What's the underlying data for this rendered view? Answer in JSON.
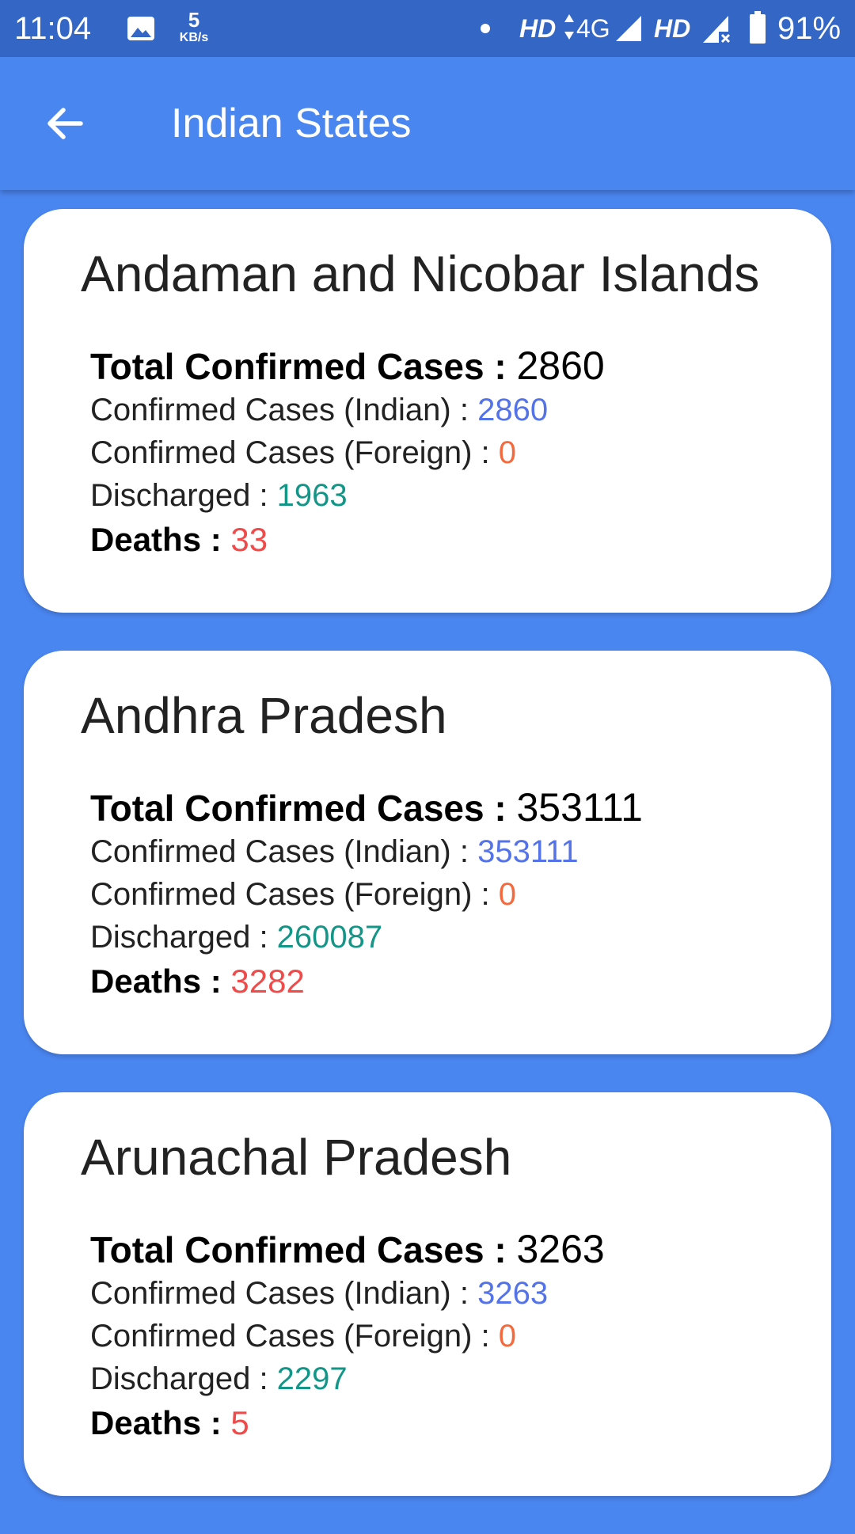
{
  "status_bar": {
    "time": "11:04",
    "speed_value": "5",
    "speed_unit": "KB/s",
    "hd_1": "HD",
    "network": "4G",
    "hd_2": "HD",
    "battery": "91%"
  },
  "app_bar": {
    "title": "Indian States",
    "back_icon": "arrow-back-icon"
  },
  "labels": {
    "total": "Total Confirmed Cases : ",
    "indian": "Confirmed Cases (Indian) : ",
    "foreign": "Confirmed Cases (Foreign) : ",
    "discharged": "Discharged : ",
    "deaths": "Deaths : "
  },
  "states": [
    {
      "name": "Andaman and Nicobar Islands",
      "total": "2860",
      "indian": "2860",
      "foreign": "0",
      "discharged": "1963",
      "deaths": "33"
    },
    {
      "name": "Andhra Pradesh",
      "total": "353111",
      "indian": "353111",
      "foreign": "0",
      "discharged": "260087",
      "deaths": "3282"
    },
    {
      "name": "Arunachal Pradesh",
      "total": "3263",
      "indian": "3263",
      "foreign": "0",
      "discharged": "2297",
      "deaths": "5"
    }
  ],
  "colors": {
    "primary": "#4a86f0",
    "status_bar": "#3366c5",
    "indian": "#5473e8",
    "foreign": "#f26a3e",
    "discharged": "#139688",
    "deaths": "#f04b4b"
  }
}
